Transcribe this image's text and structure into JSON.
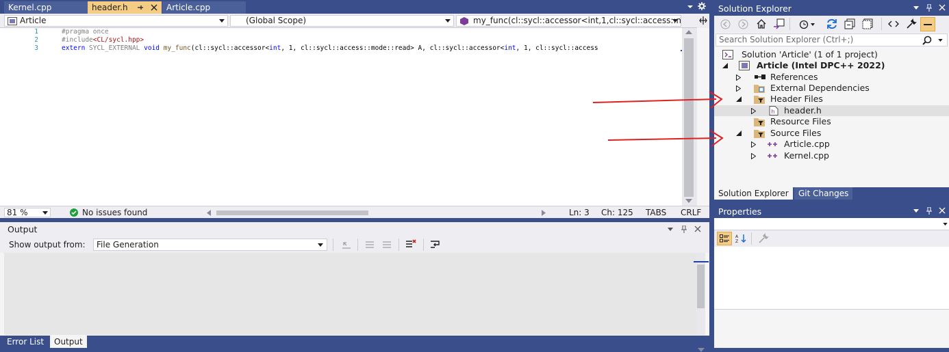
{
  "editor": {
    "tabs": [
      {
        "label": "Kernel.cpp",
        "active": false
      },
      {
        "label": "header.h",
        "active": true
      },
      {
        "label": "Article.cpp",
        "active": false
      }
    ],
    "nav": {
      "project": "Article",
      "scope": "(Global Scope)",
      "member": "my_func(cl::sycl::accessor<int,1,cl::sycl::access::m"
    },
    "code": {
      "line_numbers": [
        "1",
        "2",
        "3"
      ],
      "line1": "#pragma once",
      "line2_directive": "#include",
      "line2_path": "<CL/sycl.hpp>",
      "line3_extern": "extern",
      "line3_macro": " SYCL_EXTERNAL ",
      "line3_void": "void",
      "line3_name": " my_func",
      "line3_p1": "(cl::sycl::accessor<",
      "line3_int1": "int",
      "line3_p2": ", 1, cl::sycl::access::mode::read> A, cl::sycl::accessor<",
      "line3_int2": "int",
      "line3_p3": ", 1, cl::sycl::access"
    },
    "status": {
      "zoom": "81 %",
      "issues": "No issues found",
      "line": "Ln: 3",
      "col": "Ch: 125",
      "indent": "TABS",
      "eol": "CRLF"
    }
  },
  "output": {
    "title": "Output",
    "show_from_label": "Show output from:",
    "source": "File Generation"
  },
  "bottom_tabs": [
    {
      "label": "Error List",
      "active": false
    },
    {
      "label": "Output",
      "active": true
    }
  ],
  "solution_explorer": {
    "title": "Solution Explorer",
    "search_placeholder": "Search Solution Explorer (Ctrl+;)",
    "tree": [
      {
        "label": "Solution 'Article' (1 of 1 project)",
        "bold": false
      },
      {
        "label": "Article (Intel DPC++ 2022)",
        "bold": true
      },
      {
        "label": "References"
      },
      {
        "label": "External Dependencies"
      },
      {
        "label": "Header Files"
      },
      {
        "label": "header.h"
      },
      {
        "label": "Resource Files"
      },
      {
        "label": "Source Files"
      },
      {
        "label": "Article.cpp"
      },
      {
        "label": "Kernel.cpp"
      }
    ],
    "tabs": [
      {
        "label": "Solution Explorer",
        "active": true
      },
      {
        "label": "Git Changes",
        "active": false
      }
    ]
  },
  "properties": {
    "title": "Properties"
  },
  "colors": {
    "chrome": "#3a4e8c",
    "active_tab": "#f5cc84",
    "arrow": "#e02020",
    "ok_green": "#1f9e3a"
  }
}
